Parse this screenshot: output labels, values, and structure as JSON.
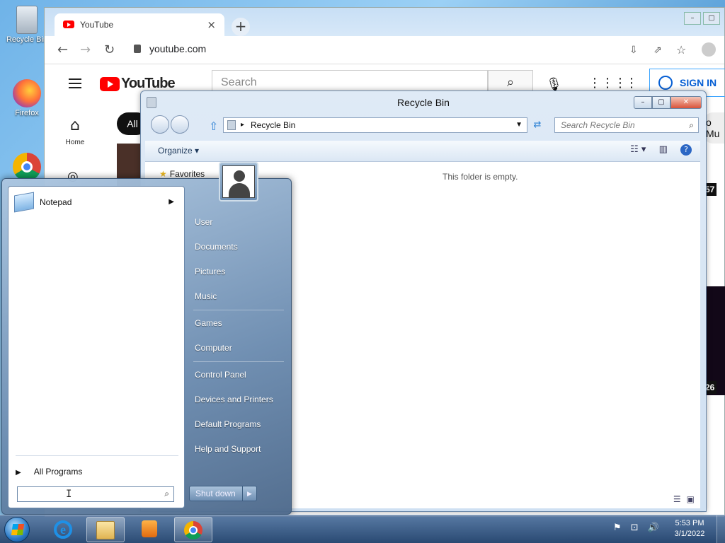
{
  "desktop": {
    "icons": [
      {
        "label": "Recycle Bin",
        "icon": "recycle-bin-icon"
      },
      {
        "label": "Firefox",
        "icon": "firefox-icon"
      },
      {
        "label": "",
        "icon": "chrome-icon"
      }
    ]
  },
  "chrome": {
    "tab_title": "YouTube",
    "tab_close": "×",
    "new_tab": "+",
    "url": "youtube.com",
    "window_buttons": [
      "–",
      "▢"
    ]
  },
  "youtube": {
    "logo_text": "YouTube",
    "search_placeholder": "Search",
    "sign_in": "SIGN IN",
    "chip_all": "All",
    "nav_home": "Home",
    "edge_texts": [
      "o Mu",
      "57",
      "26"
    ]
  },
  "recycle_bin": {
    "title": "Recycle Bin",
    "address": "Recycle Bin",
    "search_placeholder": "Search Recycle Bin",
    "organize": "Organize",
    "favorites": "Favorites",
    "empty_message": "This folder is empty.",
    "window_buttons": {
      "minimize": "–",
      "maximize": "▢",
      "close": "✕"
    }
  },
  "start_menu": {
    "pinned": [
      {
        "label": "Notepad",
        "icon": "notepad-icon"
      }
    ],
    "all_programs": "All Programs",
    "search_cursor": "I",
    "right_links": [
      "User",
      "Documents",
      "Pictures",
      "Music",
      "Games",
      "Computer",
      "Control Panel",
      "Devices and Printers",
      "Default Programs",
      "Help and Support"
    ],
    "shutdown": "Shut down"
  },
  "taskbar": {
    "apps": [
      {
        "name": "Internet Explorer",
        "icon": "ie-icon"
      },
      {
        "name": "Windows Explorer",
        "icon": "folder-icon"
      },
      {
        "name": "Windows Media Player",
        "icon": "media-player-icon"
      },
      {
        "name": "Google Chrome",
        "icon": "chrome-icon"
      }
    ],
    "time": "5:53 PM",
    "date": "3/1/2022"
  }
}
